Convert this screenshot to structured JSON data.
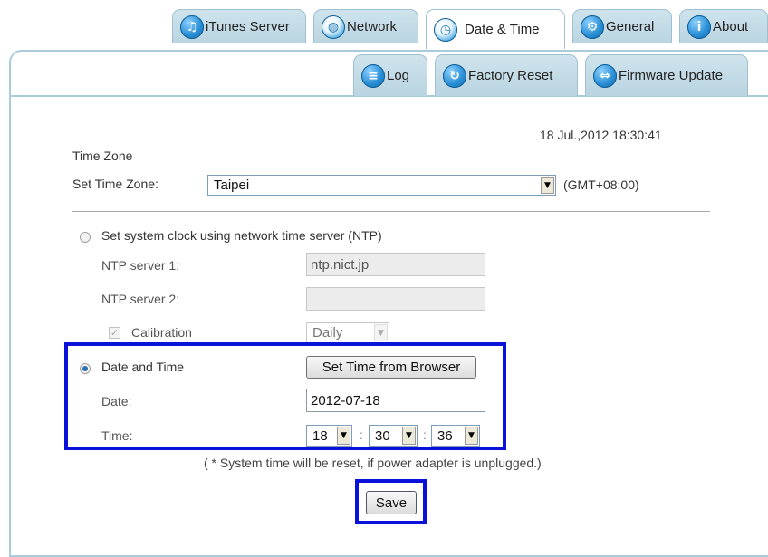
{
  "tabs_top": [
    {
      "label": "iTunes Server",
      "icon": "music-note-icon"
    },
    {
      "label": "Network",
      "icon": "network-globe-icon"
    },
    {
      "label": "Date & Time",
      "icon": "clock-icon",
      "active": true
    },
    {
      "label": "General",
      "icon": "gear-icon"
    },
    {
      "label": "About",
      "icon": "info-icon"
    }
  ],
  "tabs_sub": [
    {
      "label": "Log",
      "icon": "log-icon"
    },
    {
      "label": "Factory Reset",
      "icon": "reset-icon"
    },
    {
      "label": "Firmware Update",
      "icon": "firmware-update-icon"
    }
  ],
  "current_datetime": "18 Jul.,2012 18:30:41",
  "timezone": {
    "section_title": "Time Zone",
    "label": "Set Time Zone:",
    "value": "Taipei",
    "offset": "(GMT+08:00)"
  },
  "ntp": {
    "option_label": "Set system clock using network time server (NTP)",
    "server1_label": "NTP server 1:",
    "server1_value": "ntp.nict.jp",
    "server2_label": "NTP server 2:",
    "server2_value": "",
    "calibration_label": "Calibration",
    "calibration_value": "Daily"
  },
  "manual": {
    "option_label": "Date and Time",
    "browser_button": "Set Time from Browser",
    "date_label": "Date:",
    "date_value": "2012-07-18",
    "time_label": "Time:",
    "hour": "18",
    "minute": "30",
    "second": "36",
    "separator": ":"
  },
  "note": "( * System time will be reset, if power adapter is unplugged.)",
  "save_label": "Save",
  "colors": {
    "highlight": "#0a12d9",
    "tab": "#b9d4e1",
    "panel_border": "#aacbdc"
  }
}
